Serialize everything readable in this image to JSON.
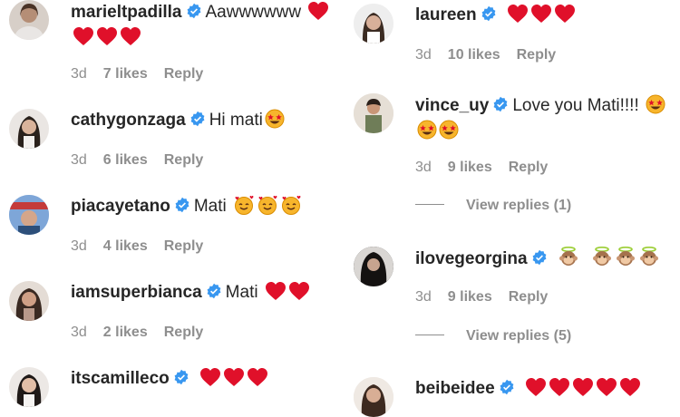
{
  "left": [
    {
      "username": "marieltpadilla",
      "text": "Aawwwwww",
      "emoji_line1": "heart",
      "heart_count_inline": 1,
      "heart_count_line2": 3,
      "age": "3d",
      "likes": "7 likes",
      "reply": "Reply"
    },
    {
      "username": "cathygonzaga",
      "text": "Hi mati",
      "emoji": "star-struck",
      "emoji_count": 1,
      "age": "3d",
      "likes": "6 likes",
      "reply": "Reply"
    },
    {
      "username": "piacayetano",
      "text": "Mati",
      "emoji": "smiling-hearts",
      "emoji_count": 3,
      "age": "3d",
      "likes": "4 likes",
      "reply": "Reply"
    },
    {
      "username": "iamsuperbianca",
      "text": "Mati",
      "emoji": "heart",
      "emoji_count": 2,
      "age": "3d",
      "likes": "2 likes",
      "reply": "Reply"
    },
    {
      "username": "itscamilleco",
      "text": "",
      "emoji": "heart",
      "emoji_count": 3
    }
  ],
  "right": [
    {
      "username": "laureen",
      "text": "",
      "emoji": "heart",
      "emoji_count": 3,
      "age": "3d",
      "likes": "10 likes",
      "reply": "Reply"
    },
    {
      "username": "vince_uy",
      "text": "Love you Mati!!!!",
      "emoji": "star-struck",
      "emoji_count_inline": 1,
      "emoji_count_line2": 2,
      "age": "3d",
      "likes": "9 likes",
      "reply": "Reply",
      "view_replies": "View replies (1)"
    },
    {
      "username": "ilovegeorgina",
      "text": "",
      "emoji": "angel-monkey",
      "emoji_count": 4,
      "age": "3d",
      "likes": "9 likes",
      "reply": "Reply",
      "view_replies": "View replies (5)"
    },
    {
      "username": "beibeidee",
      "text": "",
      "emoji": "heart",
      "emoji_count": 5
    }
  ],
  "colors": {
    "heart": "#e0102a",
    "verified": "#3897f0",
    "meta": "#8e8e8e"
  }
}
